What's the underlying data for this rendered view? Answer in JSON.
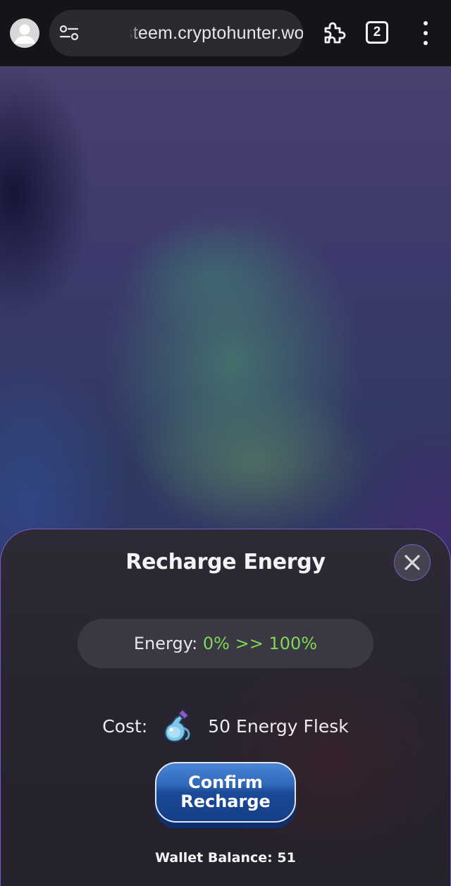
{
  "browser": {
    "url": "steem.cryptohunter.world",
    "tab_count": "2",
    "icons": [
      "account-icon",
      "site-settings-icon",
      "extensions-icon",
      "tab-switcher-icon",
      "more-menu-icon"
    ]
  },
  "modal": {
    "title": "Recharge Energy",
    "energy_label": "Energy:",
    "energy_from": "0%",
    "energy_arrow": ">>",
    "energy_to": "100%",
    "cost_label": "Cost:",
    "cost_item": "50 Energy Flesk",
    "confirm_line1": "Confirm",
    "confirm_line2": "Recharge",
    "wallet_balance": "Wallet Balance: 51"
  },
  "colors": {
    "energy_value": "#7ed957",
    "modal_border": "#7a5cc4",
    "confirm_button": "#1b4a98"
  }
}
